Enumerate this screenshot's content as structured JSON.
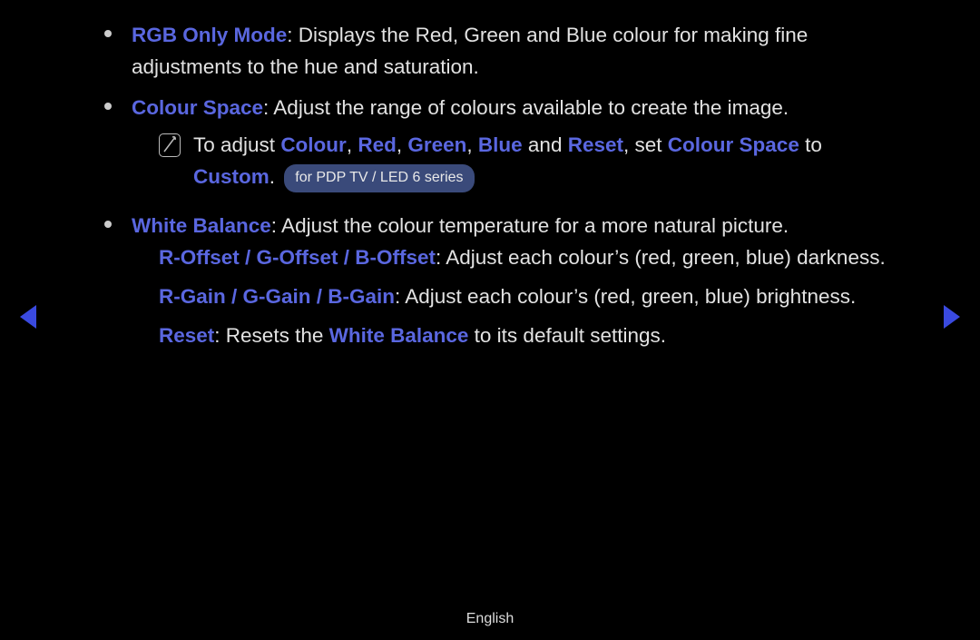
{
  "items": [
    {
      "term": "RGB Only Mode",
      "desc": ": Displays the Red, Green and Blue colour for making fine adjustments to the hue and saturation."
    }
  ],
  "colourSpace": {
    "term": "Colour Space",
    "desc": ": Adjust the range of colours available to create the image."
  },
  "note": {
    "pre": "To adjust ",
    "t1": "Colour",
    "sep": ", ",
    "t2": "Red",
    "t3": "Green",
    "t4": "Blue",
    "and": " and ",
    "t5": "Reset",
    "mid": ", set ",
    "t6": "Colour Space",
    "to": " to ",
    "t7": "Custom",
    "dot": ". ",
    "pill": "for PDP TV / LED 6 series"
  },
  "whiteBalance": {
    "term": "White Balance",
    "desc": ": Adjust the colour temperature for a more natural picture."
  },
  "offset": {
    "term": "R-Offset / G-Offset / B-Offset",
    "desc": ": Adjust each colour’s (red, green, blue) darkness."
  },
  "gain": {
    "term": "R-Gain / G-Gain / B-Gain",
    "desc": ": Adjust each colour’s (red, green, blue) brightness."
  },
  "reset": {
    "term": "Reset",
    "pre": ": Resets the ",
    "wb": "White Balance",
    "post": " to its default settings."
  },
  "footer": {
    "language": "English"
  }
}
